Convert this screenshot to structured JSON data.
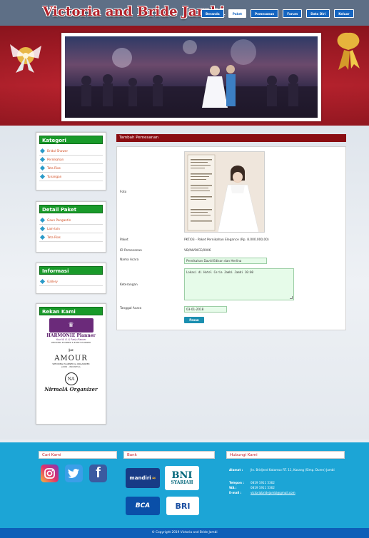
{
  "site": {
    "logo": "Victoria and Bride Jambi"
  },
  "nav": [
    {
      "label": "Beranda",
      "active": false
    },
    {
      "label": "Paket",
      "active": true
    },
    {
      "label": "Pemesanan",
      "active": false
    },
    {
      "label": "Forum",
      "active": false
    },
    {
      "label": "Data Diri",
      "active": false
    },
    {
      "label": "Keluar",
      "active": false
    }
  ],
  "sidebar": {
    "kategori": {
      "title": "Kategori",
      "items": [
        "Bridal Shower",
        "Pernikahan",
        "Tata Rias",
        "Tunangan"
      ]
    },
    "detail": {
      "title": "Detail Paket",
      "items": [
        "Gaun Pengantin",
        "Lain-lain",
        "Tata Rias"
      ]
    },
    "informasi": {
      "title": "Informasi",
      "items": [
        "Gallery"
      ]
    },
    "rekan": {
      "title": "Rekan Kami",
      "sponsors": {
        "harmonie": "HARMONIE Planner",
        "harmonie_tag": "Your W. O. & Party Planner",
        "harmonie_sub": "WEDDING PLANNER & EVENT PLANNER",
        "amour": "AMOUR",
        "amour_sub": "WEDDING PLANNER & ORGANIZER",
        "amour_sub2": "JAMBI - INDONESIA",
        "nirmala_mark": "NA",
        "nirmala": "NirmalA Organizer"
      }
    }
  },
  "main": {
    "title": "Tambah Pemesanan",
    "labels": {
      "foto": "Foto",
      "paket": "Paket",
      "id": "ID Pemesanan",
      "nama": "Nama Acara",
      "keterangan": "Keterangan",
      "tanggal": "Tanggal Acara"
    },
    "values": {
      "paket": "PKT/03 - Paket Pernikahan Elegance (Rp. 8.000.000,00)",
      "id": "VB/INVOICE/0006",
      "nama": "Pernikahan David Edison dan Herlina",
      "keterangan": "Lokasi di Hotel Ceria Jambi Jambi 10:00",
      "tanggal": "03-01-2018"
    },
    "submit_label": "Pesan"
  },
  "footer": {
    "cari": "Cari Kami",
    "bank": "Bank",
    "hubungi": "Hubungi Kami",
    "banks": {
      "mandiri": "mandiri",
      "bni": "BNI",
      "bni_sub": "SYARIAH",
      "bca": "BCA",
      "bri": "BRI"
    },
    "contact": {
      "alamat_label": "Alamat :",
      "alamat": "Jln. Bridjend Katamso RT. 11, Kasang (Simp. Duren) Jambi",
      "telepon_label": "Telepon :",
      "telepon": "0819 1911 5362",
      "wa_label": "WA :",
      "wa": "0819 1911 5362",
      "email_label": "E-mail :",
      "email": "victoriabridejambi@gmail.com"
    },
    "copyright": "© Copyright 2019 Victoria and Bride Jambi"
  },
  "colors": {
    "header": "#5e6f86",
    "banner": "#c32430",
    "nav": "#1565c0",
    "sidebar_head": "#199a2a",
    "main_head": "#8a0d12",
    "footer": "#1ca5d6",
    "copyright": "#0d5fb8"
  }
}
